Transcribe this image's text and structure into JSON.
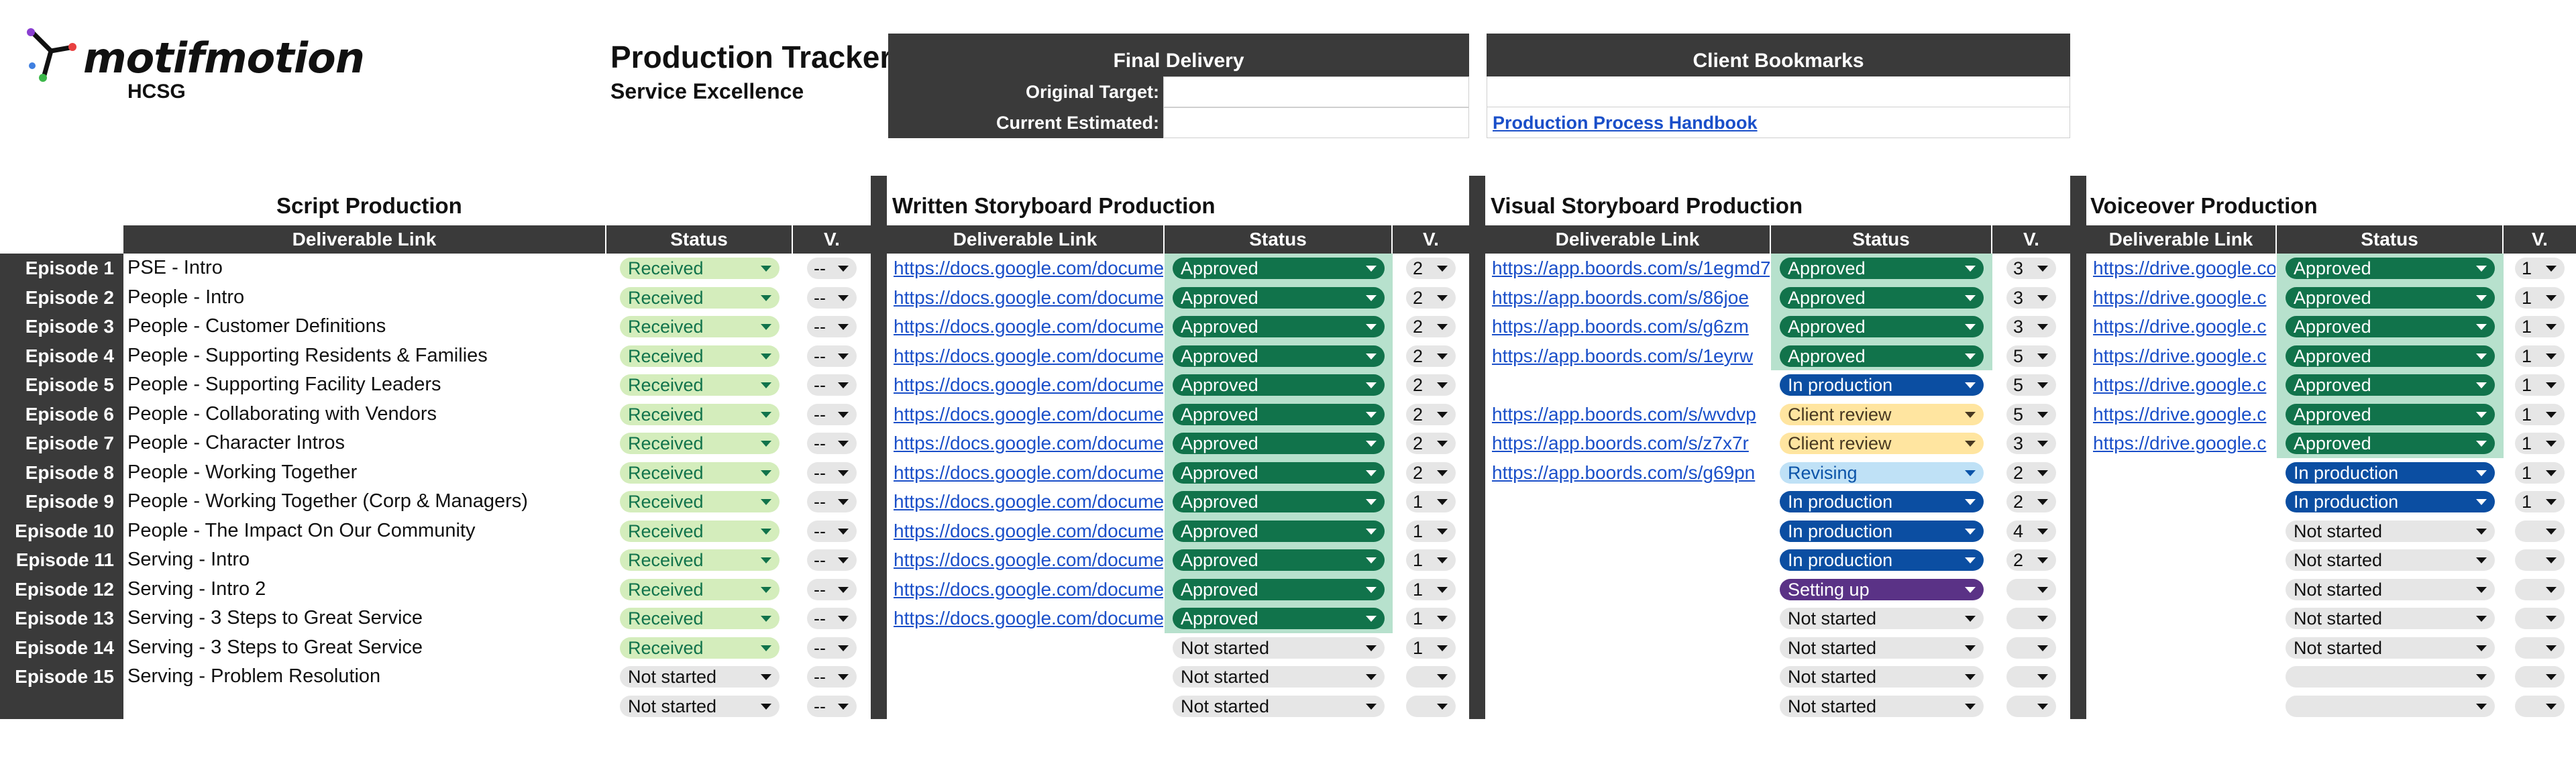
{
  "brand": {
    "name": "motifmotion",
    "client": "HCSG"
  },
  "header": {
    "title": "Production Tracker",
    "subtitle": "Service Excellence"
  },
  "final_delivery": {
    "title": "Final Delivery",
    "original_target_label": "Original Target:",
    "original_target_value": "",
    "current_estimated_label": "Current Estimated:",
    "current_estimated_value": ""
  },
  "client_bookmarks": {
    "title": "Client Bookmarks",
    "link_label": "Production Process Handbook"
  },
  "episodes": [
    "Episode 1",
    "Episode 2",
    "Episode 3",
    "Episode 4",
    "Episode 5",
    "Episode 6",
    "Episode 7",
    "Episode 8",
    "Episode 9",
    "Episode 10",
    "Episode 11",
    "Episode 12",
    "Episode 13",
    "Episode 14",
    "Episode 15"
  ],
  "script": {
    "title": "Script Production",
    "col_link": "Deliverable Link",
    "col_status": "Status",
    "col_version": "V.",
    "rows": [
      {
        "text": "PSE - Intro",
        "status": "Received",
        "status_kind": "received",
        "version": "--"
      },
      {
        "text": "People - Intro",
        "status": "Received",
        "status_kind": "received",
        "version": "--"
      },
      {
        "text": "People - Customer Definitions",
        "status": "Received",
        "status_kind": "received",
        "version": "--"
      },
      {
        "text": "People - Supporting Residents & Families",
        "status": "Received",
        "status_kind": "received",
        "version": "--"
      },
      {
        "text": "People - Supporting Facility Leaders",
        "status": "Received",
        "status_kind": "received",
        "version": "--"
      },
      {
        "text": "People - Collaborating with Vendors",
        "status": "Received",
        "status_kind": "received",
        "version": "--"
      },
      {
        "text": "People - Character Intros",
        "status": "Received",
        "status_kind": "received",
        "version": "--"
      },
      {
        "text": "People - Working Together",
        "status": "Received",
        "status_kind": "received",
        "version": "--"
      },
      {
        "text": "People - Working Together (Corp & Managers)",
        "status": "Received",
        "status_kind": "received",
        "version": "--"
      },
      {
        "text": "People - The Impact On Our Community",
        "status": "Received",
        "status_kind": "received",
        "version": "--"
      },
      {
        "text": "Serving - Intro",
        "status": "Received",
        "status_kind": "received",
        "version": "--"
      },
      {
        "text": "Serving - Intro 2",
        "status": "Received",
        "status_kind": "received",
        "version": "--"
      },
      {
        "text": "Serving - 3 Steps to Great Service",
        "status": "Received",
        "status_kind": "received",
        "version": "--"
      },
      {
        "text": "Serving - 3 Steps to Great Service",
        "status": "Received",
        "status_kind": "received",
        "version": "--"
      },
      {
        "text": "Serving - Problem Resolution",
        "status": "Not started",
        "status_kind": "ns",
        "version": "--"
      },
      {
        "text": "",
        "status": "Not started",
        "status_kind": "ns",
        "version": "--"
      }
    ]
  },
  "written": {
    "title": "Written Storyboard Production",
    "col_link": "Deliverable Link",
    "col_status": "Status",
    "col_version": "V.",
    "rows": [
      {
        "link": "https://docs.google.com/documen",
        "status": "Approved",
        "status_kind": "approved",
        "version": "2"
      },
      {
        "link": "https://docs.google.com/documen",
        "status": "Approved",
        "status_kind": "approved",
        "version": "2"
      },
      {
        "link": "https://docs.google.com/documen",
        "status": "Approved",
        "status_kind": "approved",
        "version": "2"
      },
      {
        "link": "https://docs.google.com/documen",
        "status": "Approved",
        "status_kind": "approved",
        "version": "2"
      },
      {
        "link": "https://docs.google.com/documen",
        "status": "Approved",
        "status_kind": "approved",
        "version": "2"
      },
      {
        "link": "https://docs.google.com/documen",
        "status": "Approved",
        "status_kind": "approved",
        "version": "2"
      },
      {
        "link": "https://docs.google.com/documen",
        "status": "Approved",
        "status_kind": "approved",
        "version": "2"
      },
      {
        "link": "https://docs.google.com/documen",
        "status": "Approved",
        "status_kind": "approved",
        "version": "2"
      },
      {
        "link": "https://docs.google.com/documen",
        "status": "Approved",
        "status_kind": "approved",
        "version": "1"
      },
      {
        "link": "https://docs.google.com/documen",
        "status": "Approved",
        "status_kind": "approved",
        "version": "1"
      },
      {
        "link": "https://docs.google.com/documen",
        "status": "Approved",
        "status_kind": "approved",
        "version": "1"
      },
      {
        "link": "https://docs.google.com/documen",
        "status": "Approved",
        "status_kind": "approved",
        "version": "1"
      },
      {
        "link": "https://docs.google.com/documen",
        "status": "Approved",
        "status_kind": "approved",
        "version": "1"
      },
      {
        "link": "",
        "status": "Not started",
        "status_kind": "ns",
        "version": "1"
      },
      {
        "link": "",
        "status": "Not started",
        "status_kind": "ns",
        "version": ""
      },
      {
        "link": "",
        "status": "Not started",
        "status_kind": "ns",
        "version": ""
      }
    ]
  },
  "visual": {
    "title": "Visual Storyboard Production",
    "col_link": "Deliverable Link",
    "col_status": "Status",
    "col_version": "V.",
    "rows": [
      {
        "link": "https://app.boords.com/s/1egmd7",
        "status": "Approved",
        "status_kind": "approved",
        "version": "3"
      },
      {
        "link": "https://app.boords.com/s/86joe",
        "status": "Approved",
        "status_kind": "approved",
        "version": "3"
      },
      {
        "link": "https://app.boords.com/s/g6zm",
        "status": "Approved",
        "status_kind": "approved",
        "version": "3"
      },
      {
        "link": "https://app.boords.com/s/1eyrw",
        "status": "Approved",
        "status_kind": "approved",
        "version": "5"
      },
      {
        "link": "",
        "status": "In production",
        "status_kind": "prod",
        "version": "5"
      },
      {
        "link": "https://app.boords.com/s/wvdvp",
        "status": "Client review",
        "status_kind": "review",
        "version": "5"
      },
      {
        "link": "https://app.boords.com/s/z7x7r",
        "status": "Client review",
        "status_kind": "review",
        "version": "3"
      },
      {
        "link": "https://app.boords.com/s/g69pn",
        "status": "Revising",
        "status_kind": "revising",
        "version": "2"
      },
      {
        "link": "",
        "status": "In production",
        "status_kind": "prod",
        "version": "2"
      },
      {
        "link": "",
        "status": "In production",
        "status_kind": "prod",
        "version": "4"
      },
      {
        "link": "",
        "status": "In production",
        "status_kind": "prod",
        "version": "2"
      },
      {
        "link": "",
        "status": "Setting up",
        "status_kind": "setup",
        "version": ""
      },
      {
        "link": "",
        "status": "Not started",
        "status_kind": "ns",
        "version": ""
      },
      {
        "link": "",
        "status": "Not started",
        "status_kind": "ns",
        "version": ""
      },
      {
        "link": "",
        "status": "Not started",
        "status_kind": "ns",
        "version": ""
      },
      {
        "link": "",
        "status": "Not started",
        "status_kind": "ns",
        "version": ""
      }
    ]
  },
  "voiceover": {
    "title": "Voiceover Production",
    "col_link": "Deliverable Link",
    "col_status": "Status",
    "col_version": "V.",
    "rows": [
      {
        "link": "https://drive.google.co",
        "status": "Approved",
        "status_kind": "approved",
        "version": "1"
      },
      {
        "link": "https://drive.google.c",
        "status": "Approved",
        "status_kind": "approved",
        "version": "1"
      },
      {
        "link": "https://drive.google.c",
        "status": "Approved",
        "status_kind": "approved",
        "version": "1"
      },
      {
        "link": "https://drive.google.c",
        "status": "Approved",
        "status_kind": "approved",
        "version": "1"
      },
      {
        "link": "https://drive.google.c",
        "status": "Approved",
        "status_kind": "approved",
        "version": "1"
      },
      {
        "link": "https://drive.google.c",
        "status": "Approved",
        "status_kind": "approved",
        "version": "1"
      },
      {
        "link": "https://drive.google.c",
        "status": "Approved",
        "status_kind": "approved",
        "version": "1"
      },
      {
        "link": "",
        "status": "In production",
        "status_kind": "prod",
        "version": "1"
      },
      {
        "link": "",
        "status": "In production",
        "status_kind": "prod",
        "version": "1"
      },
      {
        "link": "",
        "status": "Not started",
        "status_kind": "ns",
        "version": ""
      },
      {
        "link": "",
        "status": "Not started",
        "status_kind": "ns",
        "version": ""
      },
      {
        "link": "",
        "status": "Not started",
        "status_kind": "ns",
        "version": ""
      },
      {
        "link": "",
        "status": "Not started",
        "status_kind": "ns",
        "version": ""
      },
      {
        "link": "",
        "status": "Not started",
        "status_kind": "ns",
        "version": ""
      },
      {
        "link": "",
        "status": "",
        "status_kind": "empty",
        "version": ""
      },
      {
        "link": "",
        "status": "",
        "status_kind": "empty",
        "version": ""
      }
    ]
  }
}
